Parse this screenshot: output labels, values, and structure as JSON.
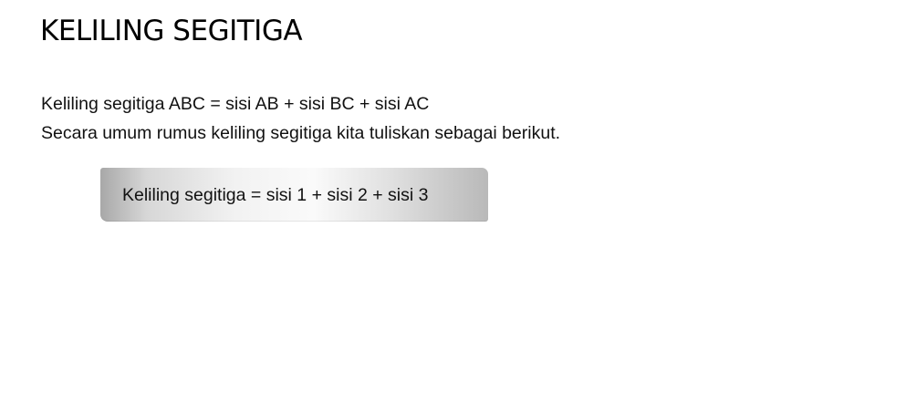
{
  "title": "KELILING SEGITIGA",
  "paragraph": {
    "line1": "Keliling segitiga ABC = sisi AB + sisi BC + sisi AC",
    "line2": "Secara umum rumus keliling segitiga kita tuliskan sebagai berikut."
  },
  "formula": "Keliling segitiga = sisi 1 + sisi 2 + sisi 3"
}
